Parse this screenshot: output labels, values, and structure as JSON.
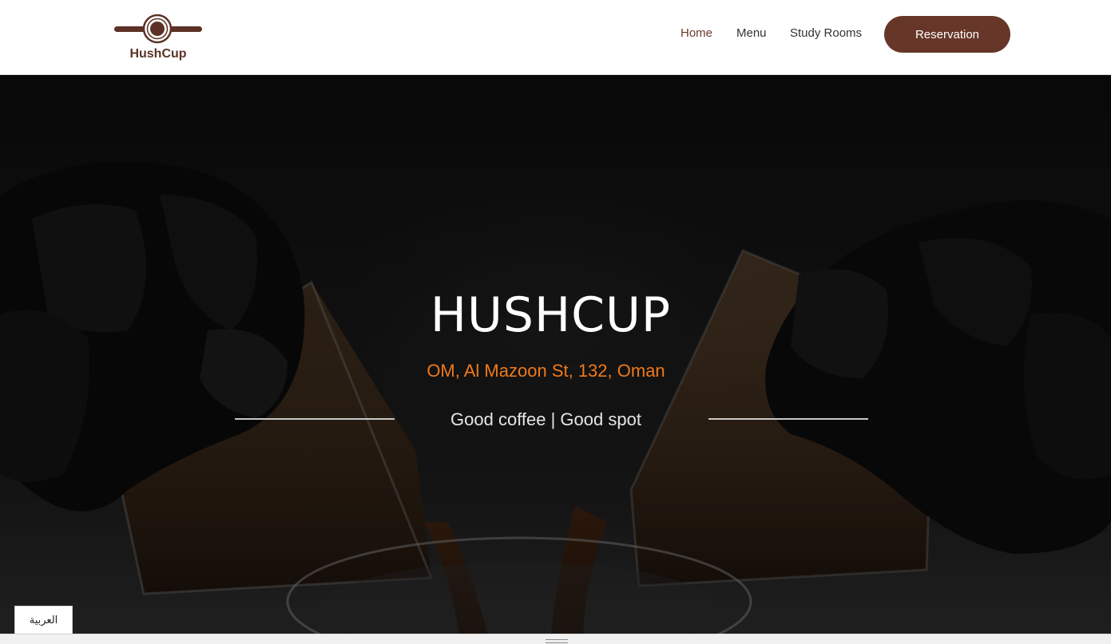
{
  "brand": {
    "name": "HushCup",
    "logo_icon": "coffee-cup-top-view-icon",
    "logo_color": "#5c3226"
  },
  "nav": {
    "items": [
      {
        "label": "Home",
        "active": true
      },
      {
        "label": "Menu",
        "active": false
      },
      {
        "label": "Study Rooms",
        "active": false
      }
    ],
    "reservation_label": "Reservation"
  },
  "hero": {
    "title": "HUSHCUP",
    "address": "OM, Al Mazoon St, 132, Oman",
    "tagline": "Good coffee | Good spot",
    "background_description_icon": "pouring-coffee-photo"
  },
  "language_switch": {
    "label": "العربية"
  },
  "colors": {
    "brand_brown": "#663629",
    "active_nav": "#6b3a2a",
    "accent_orange": "#ef7a1c",
    "hero_text": "#ffffff"
  }
}
